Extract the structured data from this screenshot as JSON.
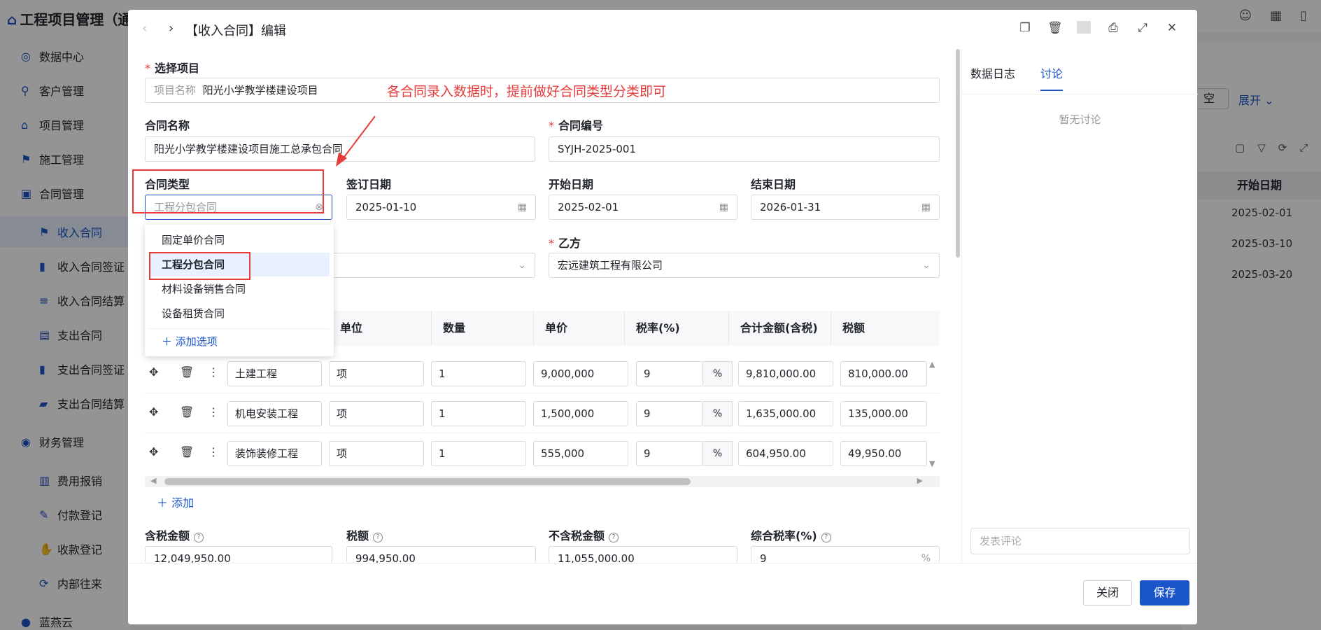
{
  "app": {
    "title": "工程项目管理（通",
    "sidebar": [
      {
        "label": "数据中心",
        "icon": "compass-icon",
        "glyph": "◎"
      },
      {
        "label": "客户管理",
        "icon": "user-search-icon",
        "glyph": "⚲"
      },
      {
        "label": "项目管理",
        "icon": "house-icon",
        "glyph": "⌂"
      },
      {
        "label": "施工管理",
        "icon": "pin-icon",
        "glyph": "⚑"
      },
      {
        "label": "合同管理",
        "icon": "briefcase-icon",
        "glyph": "▣"
      },
      {
        "label": "收入合同",
        "icon": "pin-icon",
        "glyph": "⚑"
      },
      {
        "label": "收入合同签证",
        "icon": "bar-chart-icon",
        "glyph": "▮"
      },
      {
        "label": "收入合同结算",
        "icon": "list-icon",
        "glyph": "≡"
      },
      {
        "label": "支出合同",
        "icon": "pay-icon",
        "glyph": "▤"
      },
      {
        "label": "支出合同签证",
        "icon": "bar-chart-icon",
        "glyph": "▮"
      },
      {
        "label": "支出合同结算",
        "icon": "folder-icon",
        "glyph": "▰"
      },
      {
        "label": "财务管理",
        "icon": "coins-icon",
        "glyph": "◉"
      },
      {
        "label": "费用报销",
        "icon": "money-icon",
        "glyph": "▥"
      },
      {
        "label": "付款登记",
        "icon": "edit-icon",
        "glyph": "✎"
      },
      {
        "label": "收款登记",
        "icon": "hand-icon",
        "glyph": "✋"
      },
      {
        "label": "内部往来",
        "icon": "refresh-icon",
        "glyph": "⟳"
      },
      {
        "label": "蓝燕云",
        "icon": "logo-icon",
        "glyph": "●"
      }
    ],
    "bg": {
      "clear_button": "空",
      "expand": "展开",
      "start_date_header": "开始日期",
      "rows": [
        "2025-02-01",
        "2025-03-10",
        "2025-03-20"
      ]
    }
  },
  "modal": {
    "title": "【收入合同】编辑",
    "select_project": {
      "label": "选择项目",
      "field_label": "项目名称",
      "value": "阳光小学教学楼建设项目"
    },
    "annotation": "各合同录入数据时，提前做好合同类型分类即可",
    "contract_name": {
      "label": "合同名称",
      "value": "阳光小学教学楼建设项目施工总承包合同"
    },
    "contract_no": {
      "label": "合同编号",
      "value": "SYJH-2025-001"
    },
    "contract_type": {
      "label": "合同类型",
      "placeholder": "工程分包合同"
    },
    "sign_date": {
      "label": "签订日期",
      "value": "2025-01-10"
    },
    "start_date": {
      "label": "开始日期",
      "value": "2025-02-01"
    },
    "end_date": {
      "label": "结束日期",
      "value": "2026-01-31"
    },
    "party_b": {
      "label": "乙方",
      "value": "宏远建筑工程有限公司"
    },
    "dropdown": {
      "options": [
        "固定单价合同",
        "工程分包合同",
        "材料设备销售合同",
        "设备租赁合同"
      ],
      "selected_index": 1,
      "add_option": "添加选项"
    },
    "table": {
      "headers": [
        "单位",
        "数量",
        "单价",
        "税率(%)",
        "合计金额(含税)",
        "税额"
      ],
      "rows": [
        {
          "name": "土建工程",
          "unit": "项",
          "qty": "1",
          "price": "9,000,000",
          "rate": "9",
          "total": "9,810,000.00",
          "tax": "810,000.00"
        },
        {
          "name": "机电安装工程",
          "unit": "项",
          "qty": "1",
          "price": "1,500,000",
          "rate": "9",
          "total": "1,635,000.00",
          "tax": "135,000.00"
        },
        {
          "name": "装饰装修工程",
          "unit": "项",
          "qty": "1",
          "price": "555,000",
          "rate": "9",
          "total": "604,950.00",
          "tax": "49,950.00"
        }
      ],
      "percent": "%",
      "add_label": "添加"
    },
    "summary": {
      "taxed_amount": {
        "label": "含税金额",
        "value": "12,049,950.00"
      },
      "tax": {
        "label": "税额",
        "value": "994,950.00"
      },
      "untaxed_amount": {
        "label": "不含税金额",
        "value": "11,055,000.00"
      },
      "overall_rate": {
        "label": "综合税率(%)",
        "value": "9"
      }
    },
    "right_panel": {
      "tabs": [
        "数据日志",
        "讨论"
      ],
      "active_tab": 1,
      "empty_text": "暂无讨论",
      "comment_placeholder": "发表评论"
    },
    "footer": {
      "close": "关闭",
      "save": "保存"
    },
    "colors": {
      "accent": "#1a55c9",
      "annotation": "#e63b3b"
    }
  }
}
